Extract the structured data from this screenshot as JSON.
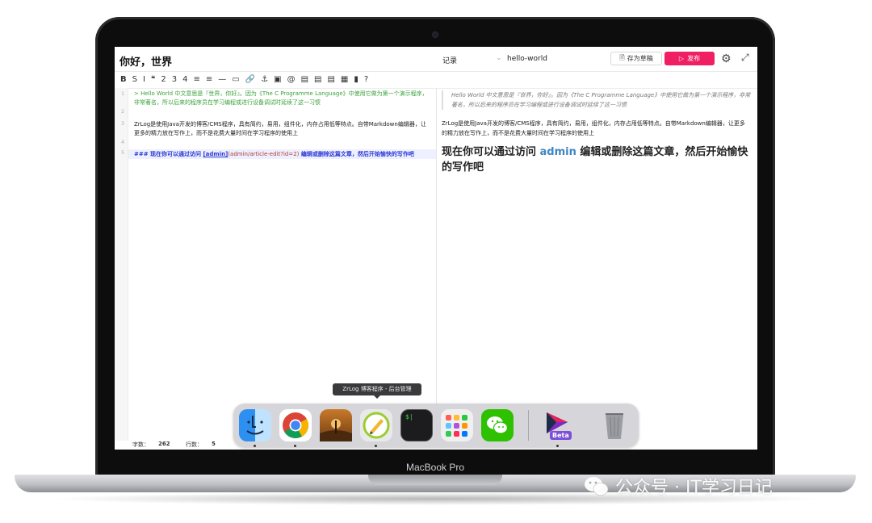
{
  "device": {
    "model_label": "MacBook Pro"
  },
  "watermark": {
    "text": "公众号 · IT学习日记"
  },
  "editor": {
    "doc_title": "你好，世界",
    "category": "记录",
    "alias": "hello-world",
    "save_draft_label": "存为草稿",
    "publish_label": "发布",
    "toolbar": [
      "B",
      "S",
      "I",
      "❝",
      "2",
      "3",
      "4",
      "≡",
      "≡",
      "—",
      "▭",
      "🔗",
      "⚓",
      "▣",
      "@",
      "▤",
      "▤",
      "▤",
      "▦",
      "▮",
      "?"
    ],
    "lines": [
      {
        "num": "1",
        "text": "> Hello World 中文意思是『世界，你好』。因为《The C Programme Language》中使用它做为第一个演示程序，非常著名，所以后来的程序员在学习编程或进行设备调试时延续了这一习惯"
      },
      {
        "num": "2",
        "text": ""
      },
      {
        "num": "3",
        "text": "ZrLog是使用Java开发的博客/CMS程序，具有简约，易用，组件化，内存占用低等特点。自带Markdown编辑器，让更多的精力放在写作上，而不是花费大量时间在学习程序的使用上"
      },
      {
        "num": "4",
        "text": ""
      },
      {
        "num": "5",
        "prefix": "### 现在你可以通过访问 ",
        "link": "[admin]",
        "url": "(admin/article-edit?id=2)",
        "suffix": " 编辑或删除这篇文章，然后开始愉快的写作吧"
      }
    ],
    "preview": {
      "quote": "Hello World 中文意思是『世界，你好』。因为《The C Programme Language》中使用它做为第一个演示程序，非常著名，所以后来的程序员在学习编程或进行设备调试时延续了这一习惯",
      "paragraph": "ZrLog是使用Java开发的博客/CMS程序，具有简约，易用，组件化，内存占用低等特点。自带Markdown编辑器，让更多的精力放在写作上，而不是花费大量时间在学习程序的使用上",
      "heading_pre": "现在你可以通过访问 ",
      "heading_link": "admin",
      "heading_post": " 编辑或删除这篇文章，然后开始愉快的写作吧"
    },
    "status": {
      "word_label": "字数：",
      "word_count": "262",
      "line_label": "行数：",
      "line_count": "5"
    }
  },
  "dock": {
    "tooltip": "ZrLog 博客程序 - 后台管理",
    "apps": [
      "finder-icon",
      "chrome-icon",
      "photo-app-icon",
      "zrlog-icon",
      "terminal-icon",
      "launchpad-icon",
      "wechat-icon",
      "beta-app-icon",
      "trash-icon"
    ],
    "beta_badge": "Beta",
    "terminal_glyph": "$|"
  }
}
